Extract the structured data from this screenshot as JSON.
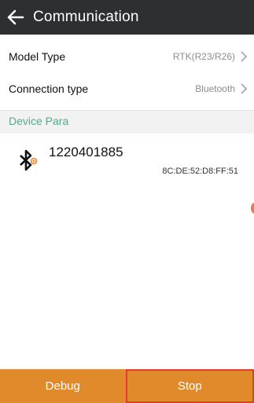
{
  "header": {
    "title": "Communication",
    "back_icon": "arrow-left-icon"
  },
  "rows": [
    {
      "label": "Model Type",
      "value": "RTK(R23/R26)"
    },
    {
      "label": "Connection type",
      "value": "Bluetooth"
    }
  ],
  "section": {
    "title": "Device Para"
  },
  "device": {
    "name": "1220401885",
    "mac": "8C:DE:52:D8:FF:51",
    "icon": "bluetooth-icon"
  },
  "footer": {
    "debug_label": "Debug",
    "stop_label": "Stop"
  },
  "colors": {
    "titlebar": "#2e2f31",
    "accent_green": "#59a889",
    "footer_orange": "#e08a2c",
    "highlight_red": "#e53935",
    "bluetooth_orange": "#f08a3a"
  }
}
